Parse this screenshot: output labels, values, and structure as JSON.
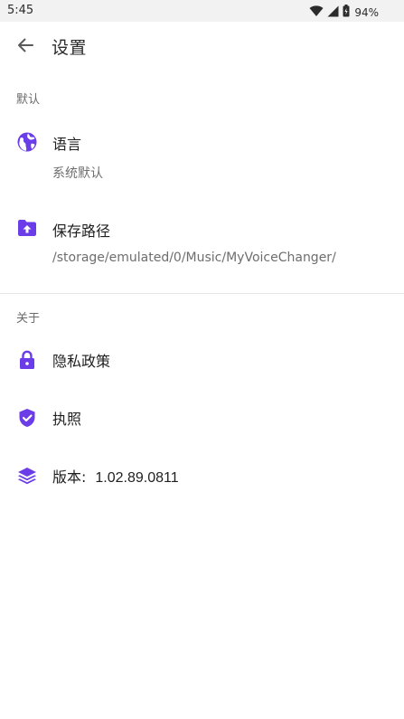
{
  "status_bar": {
    "time": "5:45",
    "battery": "94%",
    "icons": [
      "wifi-icon",
      "signal-icon",
      "battery-icon"
    ]
  },
  "toolbar": {
    "title": "设置",
    "back_icon": "arrow-back-icon"
  },
  "sections": {
    "default": {
      "header": "默认",
      "language": {
        "title": "语言",
        "summary": "系统默认",
        "icon": "globe-icon"
      },
      "save_path": {
        "title": "保存路径",
        "summary": "/storage/emulated/0/Music/MyVoiceChanger/",
        "icon": "folder-upload-icon"
      }
    },
    "about": {
      "header": "关于",
      "privacy": {
        "title": "隐私政策",
        "icon": "lock-icon"
      },
      "license": {
        "title": "执照",
        "icon": "shield-check-icon"
      },
      "version": {
        "title": "版本:",
        "value": "1.02.89.0811",
        "icon": "layers-icon"
      }
    }
  },
  "colors": {
    "accent": "#6a3de8",
    "status_bar_bg": "#f2f2f2",
    "divider": "#e6e6e6"
  }
}
